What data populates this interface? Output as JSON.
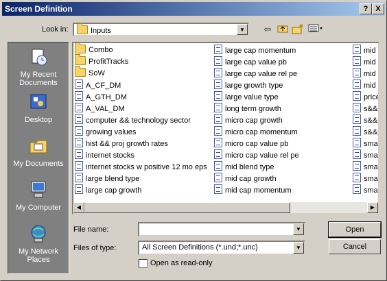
{
  "window": {
    "title": "Screen Definition"
  },
  "titlebar_buttons": {
    "help": "?",
    "close": "X"
  },
  "lookin": {
    "label": "Look in:",
    "value": "Inputs"
  },
  "toolbar": {
    "back_icon": "back-arrow-icon",
    "up_icon": "up-folder-icon",
    "new_folder_icon": "new-folder-icon",
    "view_icon": "view-menu-icon"
  },
  "places": [
    {
      "label1": "My Recent",
      "label2": "Documents",
      "icon": "recent-documents-icon"
    },
    {
      "label1": "Desktop",
      "label2": "",
      "icon": "desktop-icon"
    },
    {
      "label1": "My Documents",
      "label2": "",
      "icon": "my-documents-icon"
    },
    {
      "label1": "My Computer",
      "label2": "",
      "icon": "my-computer-icon"
    },
    {
      "label1": "My Network",
      "label2": "Places",
      "icon": "network-places-icon"
    }
  ],
  "files": {
    "col1": [
      {
        "name": "Combo",
        "type": "folder"
      },
      {
        "name": "ProfitTracks",
        "type": "folder"
      },
      {
        "name": "SoW",
        "type": "folder"
      },
      {
        "name": "A_CF_DM",
        "type": "file"
      },
      {
        "name": "A_GTH_DM",
        "type": "file"
      },
      {
        "name": "A_VAL_DM",
        "type": "file"
      },
      {
        "name": "computer && technology sector",
        "type": "file"
      },
      {
        "name": "growing values",
        "type": "file"
      },
      {
        "name": "hist && proj growth rates",
        "type": "file"
      },
      {
        "name": "internet stocks",
        "type": "file"
      },
      {
        "name": "internet stocks w positive 12 mo eps",
        "type": "file"
      },
      {
        "name": "large blend type",
        "type": "file"
      },
      {
        "name": "large cap growth",
        "type": "file"
      }
    ],
    "col2": [
      {
        "name": "large cap momentum",
        "type": "file"
      },
      {
        "name": "large cap value pb",
        "type": "file"
      },
      {
        "name": "large cap value rel pe",
        "type": "file"
      },
      {
        "name": "large growth type",
        "type": "file"
      },
      {
        "name": "large value type",
        "type": "file"
      },
      {
        "name": "long term growth",
        "type": "file"
      },
      {
        "name": "micro cap growth",
        "type": "file"
      },
      {
        "name": "micro cap momentum",
        "type": "file"
      },
      {
        "name": "micro cap value pb",
        "type": "file"
      },
      {
        "name": "micro cap value rel pe",
        "type": "file"
      },
      {
        "name": "mid blend type",
        "type": "file"
      },
      {
        "name": "mid cap growth",
        "type": "file"
      },
      {
        "name": "mid cap momentum",
        "type": "file"
      }
    ],
    "col3": [
      {
        "name": "mid c",
        "type": "file"
      },
      {
        "name": "mid c",
        "type": "file"
      },
      {
        "name": "mid g",
        "type": "file"
      },
      {
        "name": "mid v",
        "type": "file"
      },
      {
        "name": "price",
        "type": "file"
      },
      {
        "name": "s&&p",
        "type": "file"
      },
      {
        "name": "s&&p",
        "type": "file"
      },
      {
        "name": "s&&p",
        "type": "file"
      },
      {
        "name": "small",
        "type": "file"
      },
      {
        "name": "small",
        "type": "file"
      },
      {
        "name": "small",
        "type": "file"
      },
      {
        "name": "small",
        "type": "file"
      },
      {
        "name": "small",
        "type": "file"
      }
    ]
  },
  "form": {
    "filename_label": "File name:",
    "filename_value": "",
    "filetype_label": "Files of type:",
    "filetype_value": "All Screen Definitions (*.und;*.unc)",
    "readonly_label": "Open as read-only"
  },
  "buttons": {
    "open": "Open",
    "cancel": "Cancel"
  }
}
